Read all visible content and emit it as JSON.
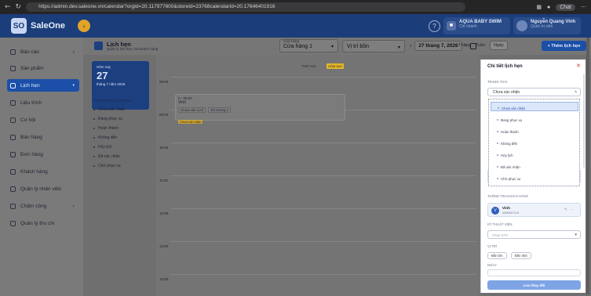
{
  "browser": {
    "url": "https://admin.dev.saleone.vn/calendar?orgId=20.117977600&storeId=23768calendarId=20.17646401916",
    "chat_label": "Chat"
  },
  "header": {
    "logo_badge": "SO",
    "logo_text": "SaleOne",
    "branch_name": "AQUA BABY SWIM",
    "branch_sub": "Chi nhánh",
    "user_name": "Nguyễn Quang Vinh",
    "user_role": "Quản trị viên"
  },
  "sidebar": {
    "items": [
      {
        "label": "Báo cáo",
        "icon": "chart-icon",
        "has_children": true
      },
      {
        "label": "Sản phẩm",
        "icon": "box-icon",
        "has_children": false
      },
      {
        "label": "Lịch hẹn",
        "icon": "calendar-icon",
        "has_children": true,
        "active": true
      },
      {
        "label": "Liệu trình",
        "icon": "list-icon",
        "has_children": false
      },
      {
        "label": "Cơ hội",
        "icon": "target-icon",
        "has_children": false
      },
      {
        "label": "Bán hàng",
        "icon": "cart-icon",
        "has_children": false
      },
      {
        "label": "Đơn hàng",
        "icon": "receipt-icon",
        "has_children": false
      },
      {
        "label": "Khách hàng",
        "icon": "user-icon",
        "has_children": false
      },
      {
        "label": "Quản lý nhân viên",
        "icon": "team-icon",
        "has_children": false
      },
      {
        "label": "Chấm công",
        "icon": "clock-icon",
        "has_children": true
      },
      {
        "label": "Quản lý thu chi",
        "icon": "wallet-icon",
        "has_children": false
      }
    ]
  },
  "toolbar": {
    "title": "Lịch hẹn",
    "subtitle": "Quản lý lịch hẹn của khách hàng",
    "store_label": "Cửa hàng",
    "store_value": "Cửa hàng 1",
    "position_value": "Vị trí bồn",
    "date": "27 tháng 7, 2026",
    "view_month": "Tháng",
    "view_week": "Tuần",
    "view_day": "Ngày",
    "add_label": "Thêm lịch hẹn"
  },
  "today_card": {
    "label": "Hôm nay",
    "day": "27",
    "month_year": "tháng 7 năm 2026"
  },
  "status_filter": {
    "heading": "TRẠNG THÁI LỊCH HẸN",
    "items": [
      "Chưa xác nhận",
      "Đang phục vụ",
      "Hoàn thành",
      "Không đến",
      "Hủy lịch",
      "Đã xác nhận",
      "Chờ phục vụ"
    ]
  },
  "calendar": {
    "day_label": "THỨ HAI",
    "today_tag": "HÔM NAY",
    "hours": [
      "08:00",
      "09:00",
      "10:00",
      "11:00",
      "12:00",
      "13:00",
      "14:00"
    ],
    "event": {
      "time": "0 - 08:00",
      "customer": "Vinh",
      "service": "Chưa xác vị trí",
      "room": "Sở lượng 1",
      "status": "Chưa xác nhận"
    }
  },
  "drawer": {
    "title": "Chi tiết lịch hẹn",
    "status_label": "TRẠNG THÁI",
    "status_value": "Chưa xác nhận",
    "options": [
      "Chưa xác nhận",
      "Đang phục vụ",
      "Hoàn thành",
      "Không đến",
      "Hủy lịch",
      "Đã xác nhận",
      "Chờ phục vụ"
    ],
    "service_combo": "Gói bơi bốn mùa cho trẻ - 12",
    "customer_label": "THÔNG TIN KHÁCH HÀNG",
    "customer_name": "Vinh",
    "customer_phone": "0395947213",
    "ktv_label": "KỸ THUẬT VIÊN",
    "ktv_placeholder": "Chọn KTV",
    "position_label": "VỊ TRÍ",
    "position_options": [
      "Bồn lớn",
      "Bồn nhỏ"
    ],
    "date_label": "NGÀY",
    "save_label": "Lưu thay đổi"
  },
  "colors": {
    "brand": "#1b3d7a",
    "accent": "#1b4fa8",
    "today_tag": "#e0b52e"
  }
}
